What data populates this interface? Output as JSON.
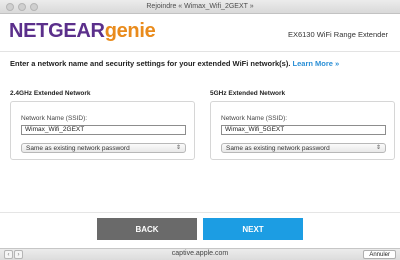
{
  "window": {
    "title": "Rejoindre « Wimax_Wifi_2GEXT »"
  },
  "header": {
    "logo_netgear": "NETGEAR",
    "logo_genie": "genie",
    "model": "EX6130 WiFi Range Extender"
  },
  "intro": {
    "text": "Enter a network name and security settings for your extended WiFi network(s).",
    "learn_more": "Learn More »"
  },
  "bands": [
    {
      "title": "2.4GHz Extended Network",
      "ssid_label": "Network Name (SSID):",
      "ssid_value": "Wimax_Wifi_2GEXT",
      "password_option": "Same as existing network password"
    },
    {
      "title": "5GHz Extended Network",
      "ssid_label": "Network Name (SSID):",
      "ssid_value": "Wimax_Wifi_5GEXT",
      "password_option": "Same as existing network password"
    }
  ],
  "footer": {
    "back_label": "BACK",
    "next_label": "NEXT"
  },
  "statusbar": {
    "back_glyph": "‹",
    "forward_glyph": "›",
    "url": "captive.apple.com",
    "cancel_label": "Annuler"
  },
  "colors": {
    "brand_purple": "#5b2f8b",
    "brand_orange": "#e98b1c",
    "link_blue": "#2a8fd6",
    "next_blue": "#1c9de3",
    "back_gray": "#6a6a6a"
  }
}
